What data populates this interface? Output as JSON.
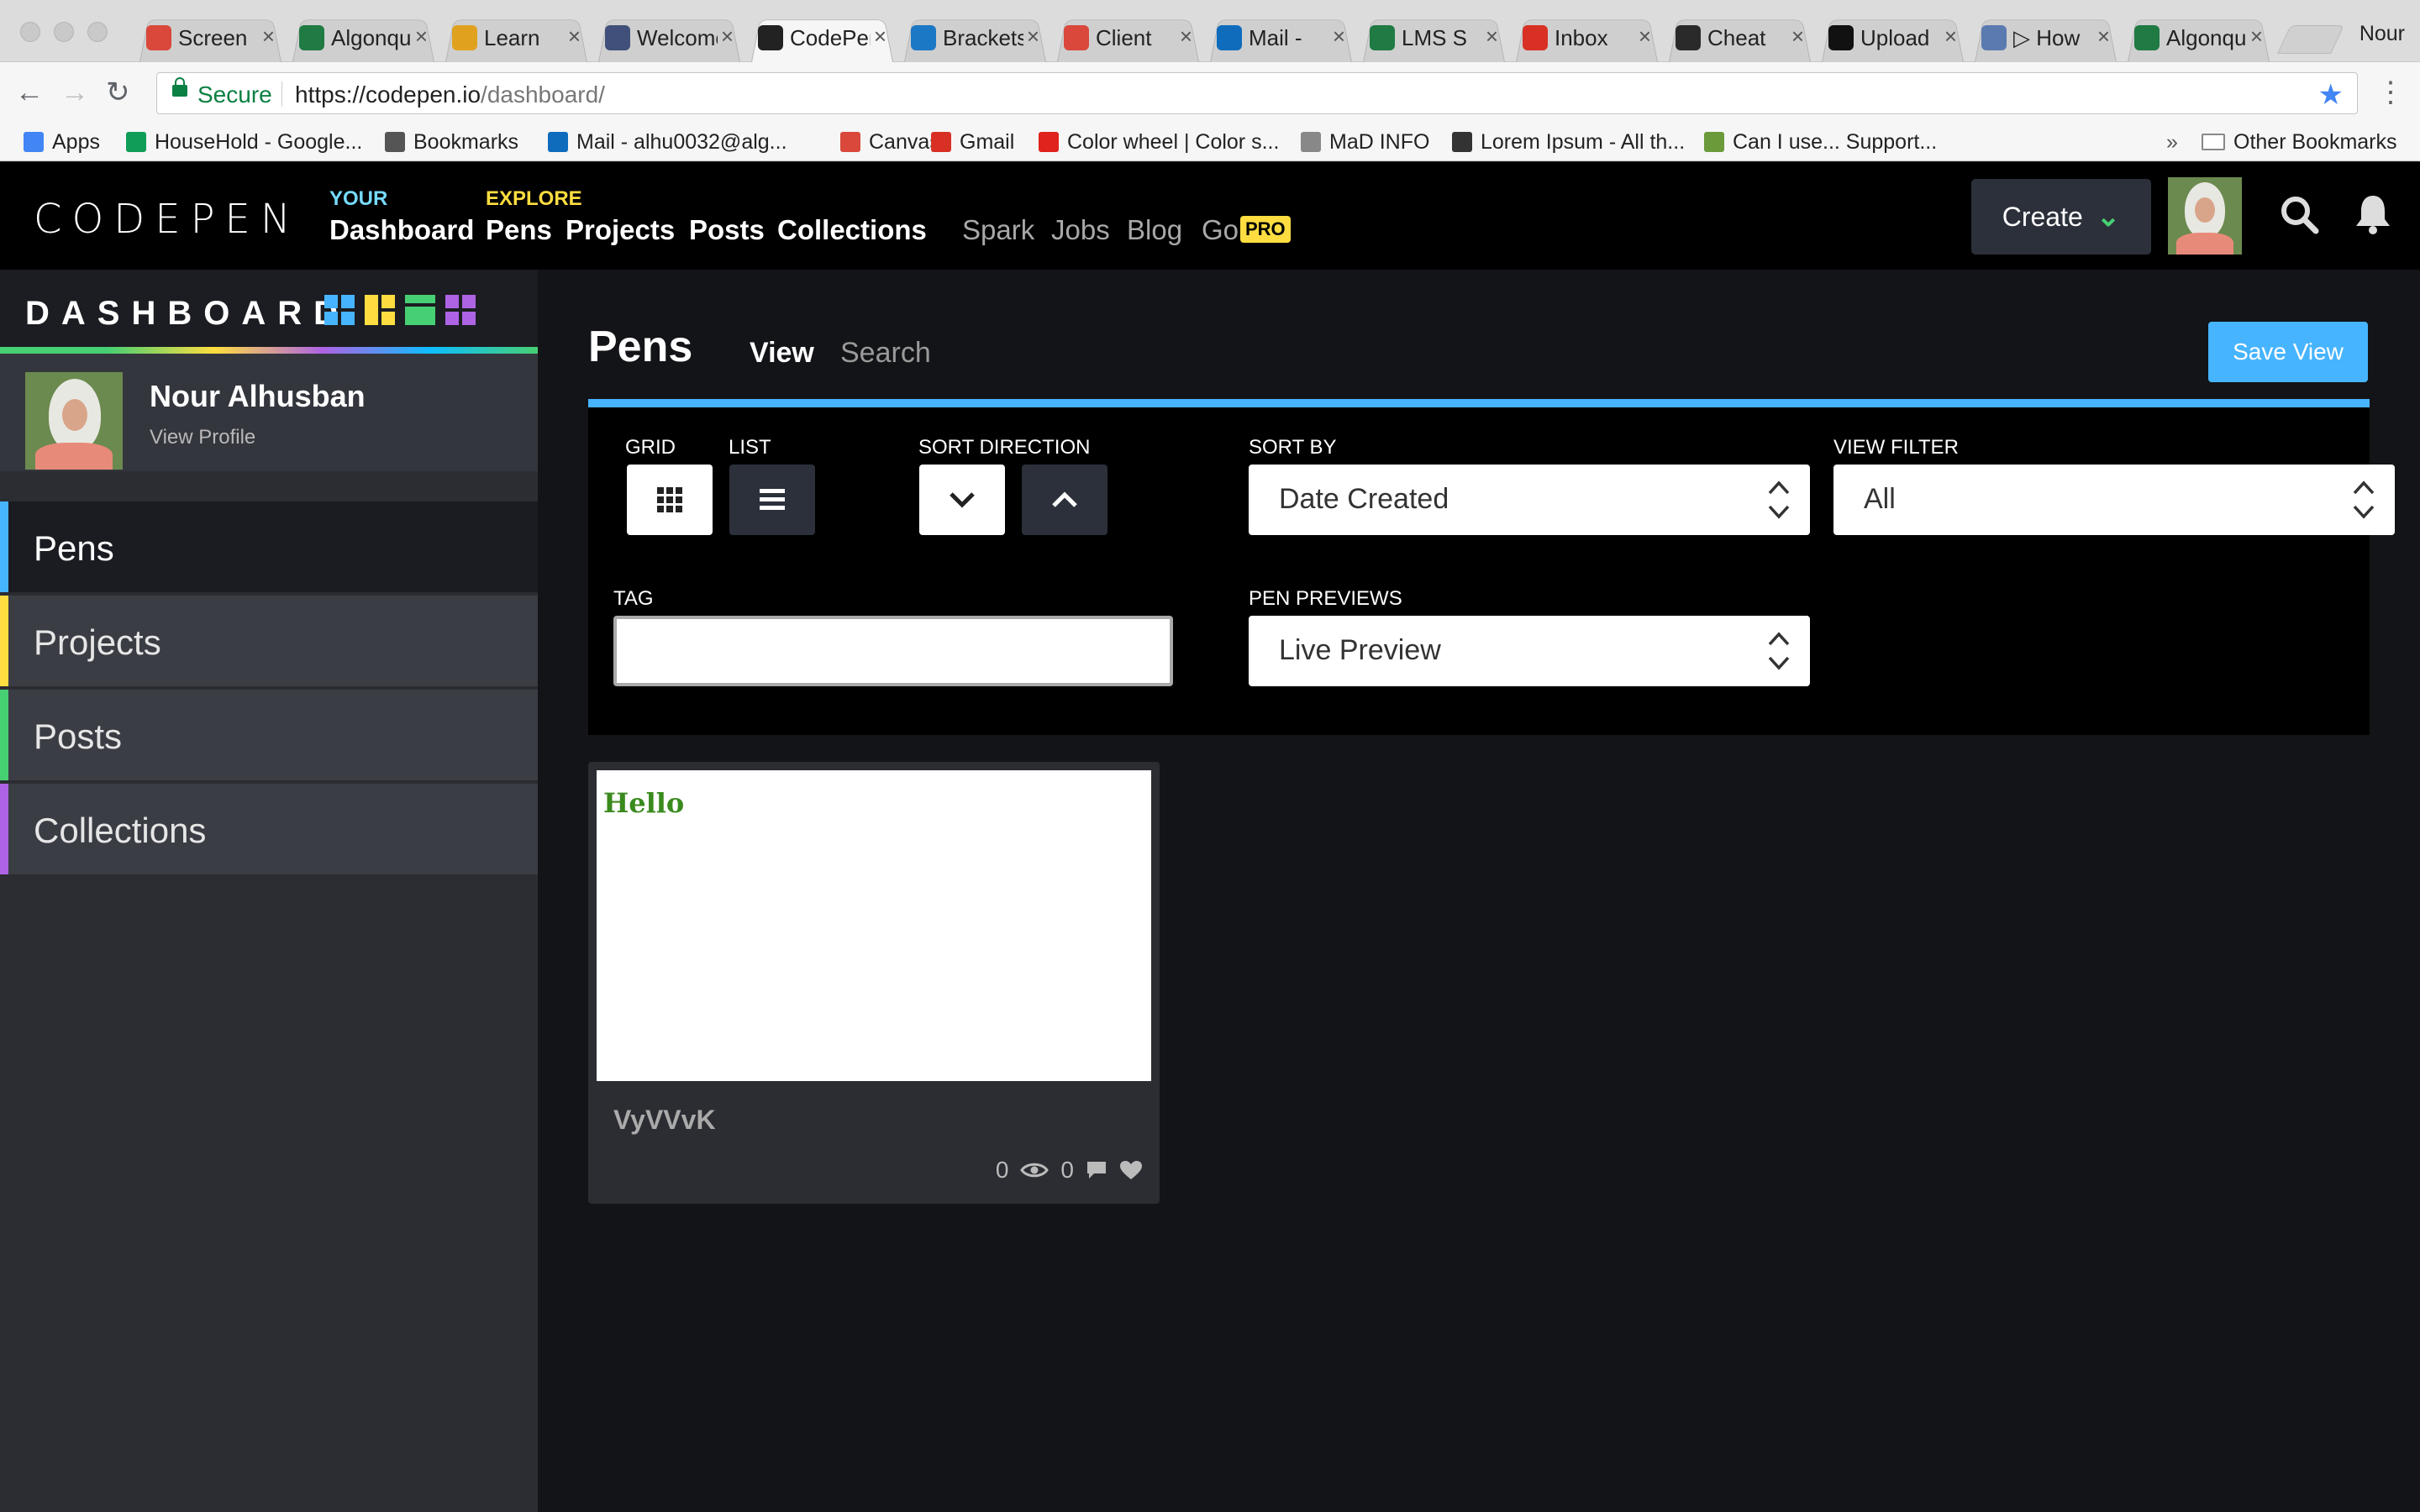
{
  "browser": {
    "tabs": [
      {
        "title": "Screen",
        "icon": "pinwheel-icon",
        "color": "#d9483b"
      },
      {
        "title": "Algonquin",
        "icon": "ac-icon",
        "color": "#1f7a43"
      },
      {
        "title": "Learn",
        "icon": "learn-icon",
        "color": "#e0a21e"
      },
      {
        "title": "Welcome",
        "icon": "welcome-icon",
        "color": "#40507a"
      },
      {
        "title": "CodePen",
        "icon": "codepen-icon",
        "color": "#222222"
      },
      {
        "title": "Brackets",
        "icon": "brackets-icon",
        "color": "#1b78c4"
      },
      {
        "title": "Client",
        "icon": "pinwheel-icon",
        "color": "#d9483b"
      },
      {
        "title": "Mail - ",
        "icon": "outlook-icon",
        "color": "#0f6cbd"
      },
      {
        "title": "LMS S",
        "icon": "ac-icon",
        "color": "#1f7a43"
      },
      {
        "title": "Inbox",
        "icon": "gmail-icon",
        "color": "#d93025"
      },
      {
        "title": "Cheat",
        "icon": "cheat-icon",
        "color": "#2a2a2a"
      },
      {
        "title": "Upload",
        "icon": "github-icon",
        "color": "#111111"
      },
      {
        "title": "▷ How",
        "icon": "doc-icon",
        "color": "#5a7ab0"
      },
      {
        "title": "Algonquin",
        "icon": "ac-icon",
        "color": "#1f7a43"
      }
    ],
    "profile_name": "Nour",
    "secure_label": "Secure",
    "url_host": "https://codepen.io",
    "url_path": "/dashboard/",
    "bookmarks": [
      {
        "label": "Apps",
        "icon": "apps-grid-icon",
        "color": "#4285f4"
      },
      {
        "label": "HouseHold - Google...",
        "icon": "sheets-icon",
        "color": "#0f9d58"
      },
      {
        "label": "Bookmarks",
        "icon": "star-icon",
        "color": "#555555"
      },
      {
        "label": "Mail - alhu0032@alg...",
        "icon": "outlook-icon",
        "color": "#0f6cbd"
      },
      {
        "label": "Canvas",
        "icon": "pinwheel-icon",
        "color": "#d9483b"
      },
      {
        "label": "Gmail",
        "icon": "gmail-icon",
        "color": "#d93025"
      },
      {
        "label": "Color wheel | Color s...",
        "icon": "adobe-icon",
        "color": "#e0231c"
      },
      {
        "label": "MaD INFO",
        "icon": "page-icon",
        "color": "#888888"
      },
      {
        "label": "Lorem Ipsum - All th...",
        "icon": "lorem-icon",
        "color": "#333333"
      },
      {
        "label": "Can I use... Support...",
        "icon": "caniuse-icon",
        "color": "#6a9a3a"
      }
    ],
    "overflow_label": "»",
    "other_bookmarks": "Other Bookmarks"
  },
  "header": {
    "logo": "CODEPEN",
    "your_label": "YOUR",
    "explore_label": "EXPLORE",
    "nav_your": [
      "Dashboard"
    ],
    "nav_explore": [
      "Pens",
      "Projects",
      "Posts",
      "Collections"
    ],
    "nav_secondary": [
      "Spark",
      "Jobs",
      "Blog",
      "Go"
    ],
    "pro_badge": "PRO",
    "create_label": "Create",
    "colors": {
      "your": "#76daff",
      "explore": "#ffdd40"
    }
  },
  "sidebar": {
    "title": "DASHBOARD",
    "profile_name": "Nour Alhusban",
    "profile_link": "View Profile",
    "items": [
      {
        "label": "Pens",
        "color": "#47b4ff",
        "active": true
      },
      {
        "label": "Projects",
        "color": "#ffdd40",
        "active": false
      },
      {
        "label": "Posts",
        "color": "#47cf73",
        "active": false
      },
      {
        "label": "Collections",
        "color": "#ae63e4",
        "active": false
      }
    ],
    "icon_colors": [
      "#47b4ff",
      "#ffdd40",
      "#47cf73",
      "#ae63e4"
    ]
  },
  "main": {
    "title": "Pens",
    "tabs": [
      "View",
      "Search"
    ],
    "save_view": "Save View",
    "filters": {
      "grid_label": "GRID",
      "list_label": "LIST",
      "sort_direction_label": "SORT DIRECTION",
      "sort_by_label": "SORT BY",
      "sort_by_value": "Date Created",
      "view_filter_label": "VIEW FILTER",
      "view_filter_value": "All",
      "tag_label": "TAG",
      "tag_value": "",
      "pen_previews_label": "PEN PREVIEWS",
      "pen_previews_value": "Live Preview"
    },
    "pens": [
      {
        "preview_text": "Hello",
        "title": "VyVVvK",
        "views": "0",
        "comments": "0"
      }
    ]
  }
}
